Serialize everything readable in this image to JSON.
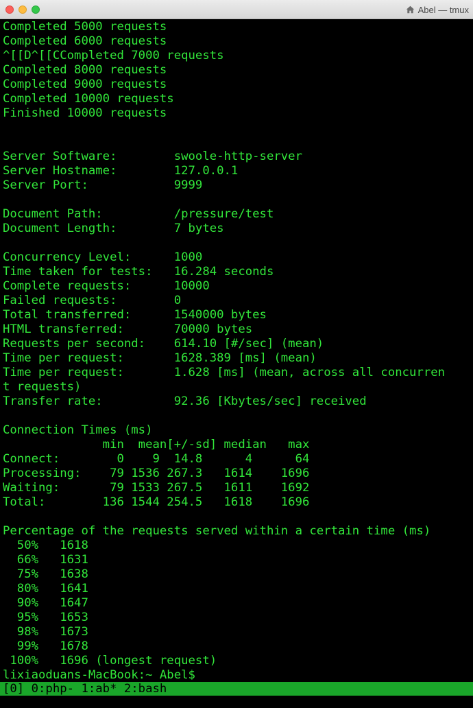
{
  "window": {
    "title": "Abel — tmux"
  },
  "terminal": {
    "lines": [
      "Completed 5000 requests",
      "Completed 6000 requests",
      "^[[D^[[CCompleted 7000 requests",
      "Completed 8000 requests",
      "Completed 9000 requests",
      "Completed 10000 requests",
      "Finished 10000 requests",
      "",
      "",
      "Server Software:        swoole-http-server",
      "Server Hostname:        127.0.0.1",
      "Server Port:            9999",
      "",
      "Document Path:          /pressure/test",
      "Document Length:        7 bytes",
      "",
      "Concurrency Level:      1000",
      "Time taken for tests:   16.284 seconds",
      "Complete requests:      10000",
      "Failed requests:        0",
      "Total transferred:      1540000 bytes",
      "HTML transferred:       70000 bytes",
      "Requests per second:    614.10 [#/sec] (mean)",
      "Time per request:       1628.389 [ms] (mean)",
      "Time per request:       1.628 [ms] (mean, across all concurren",
      "t requests)",
      "Transfer rate:          92.36 [Kbytes/sec] received",
      "",
      "Connection Times (ms)",
      "              min  mean[+/-sd] median   max",
      "Connect:        0    9  14.8      4      64",
      "Processing:    79 1536 267.3   1614    1696",
      "Waiting:       79 1533 267.5   1611    1692",
      "Total:        136 1544 254.5   1618    1696",
      "",
      "Percentage of the requests served within a certain time (ms)",
      "  50%   1618",
      "  66%   1631",
      "  75%   1638",
      "  80%   1641",
      "  90%   1647",
      "  95%   1653",
      "  98%   1673",
      "  99%   1678",
      " 100%   1696 (longest request)",
      "lixiaoduans-MacBook:~ Abel$ "
    ]
  },
  "tmux": {
    "status": "[0] 0:php- 1:ab* 2:bash"
  },
  "colors": {
    "terminal_bg": "#000000",
    "terminal_fg": "#32e63a",
    "status_bg": "#1aa62a"
  }
}
